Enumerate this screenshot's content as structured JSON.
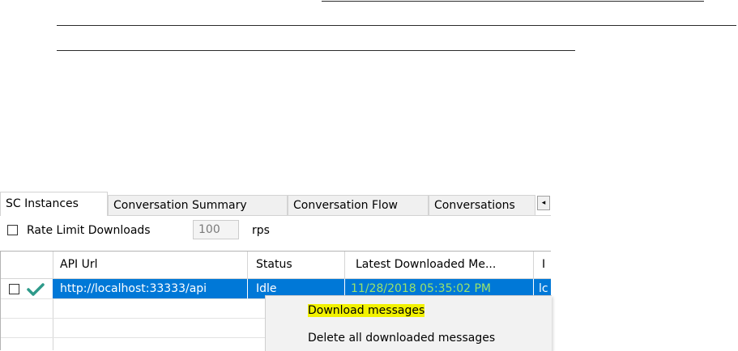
{
  "tabs": [
    {
      "label": "SC Instances",
      "active": true
    },
    {
      "label": "Conversation Summary",
      "active": false
    },
    {
      "label": "Conversation Flow",
      "active": false
    },
    {
      "label": "Conversations",
      "active": false
    }
  ],
  "tab_scroll_icon": "◂",
  "options": {
    "rate_limit_label": "Rate Limit Downloads",
    "rate_limit_checked": false,
    "rate_value": "100",
    "rate_unit": "rps"
  },
  "grid": {
    "columns": [
      "API Url",
      "Status",
      "Latest Downloaded Me...",
      "I"
    ],
    "rows": [
      {
        "selected": true,
        "checked": false,
        "status_icon": "checkmark",
        "api_url": "http://localhost:33333/api",
        "status": "Idle",
        "latest_downloaded": "11/28/2018 05:35:02 PM",
        "extra": "lc"
      }
    ]
  },
  "context_menu": {
    "items": [
      {
        "label": "Download messages",
        "highlighted": true
      },
      {
        "label": "Delete all downloaded messages",
        "highlighted": false
      }
    ]
  },
  "colors": {
    "selection": "#0078d7",
    "checkmark": "#2e9a8a",
    "highlight": "#f2f200"
  }
}
